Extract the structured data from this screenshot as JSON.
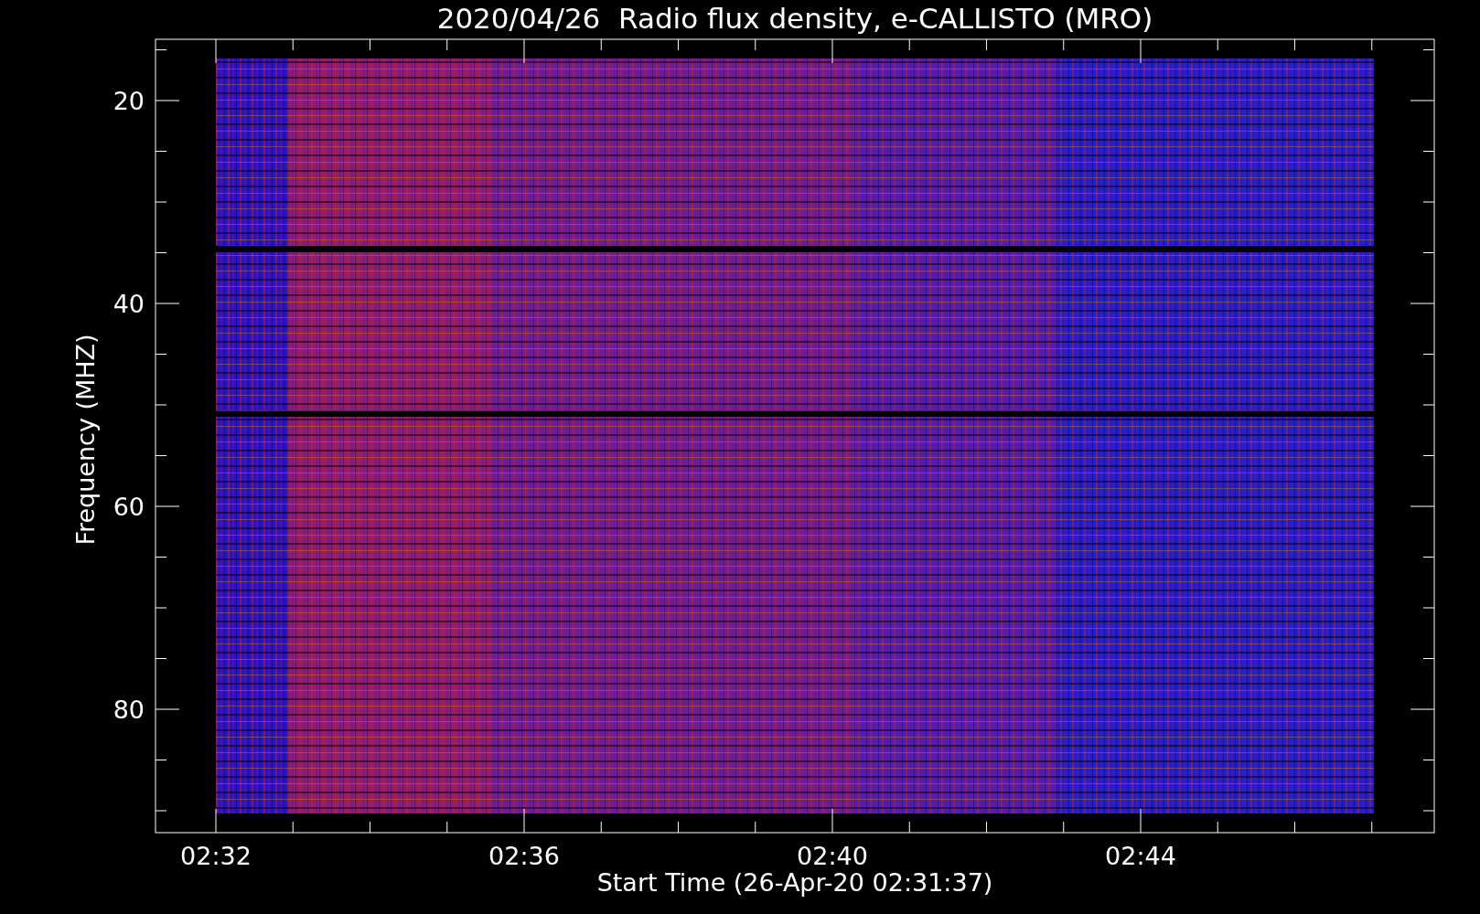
{
  "title": "2020/04/26  Radio flux density, e-CALLISTO (MRO)",
  "y_axis": {
    "label": "Frequency (MHZ)",
    "tick_labels": [
      "20",
      "40",
      "60",
      "80"
    ]
  },
  "x_axis": {
    "label": "Start Time (26-Apr-20 02:31:37)",
    "tick_labels": [
      "02:32",
      "02:36",
      "02:40",
      "02:44"
    ]
  }
}
